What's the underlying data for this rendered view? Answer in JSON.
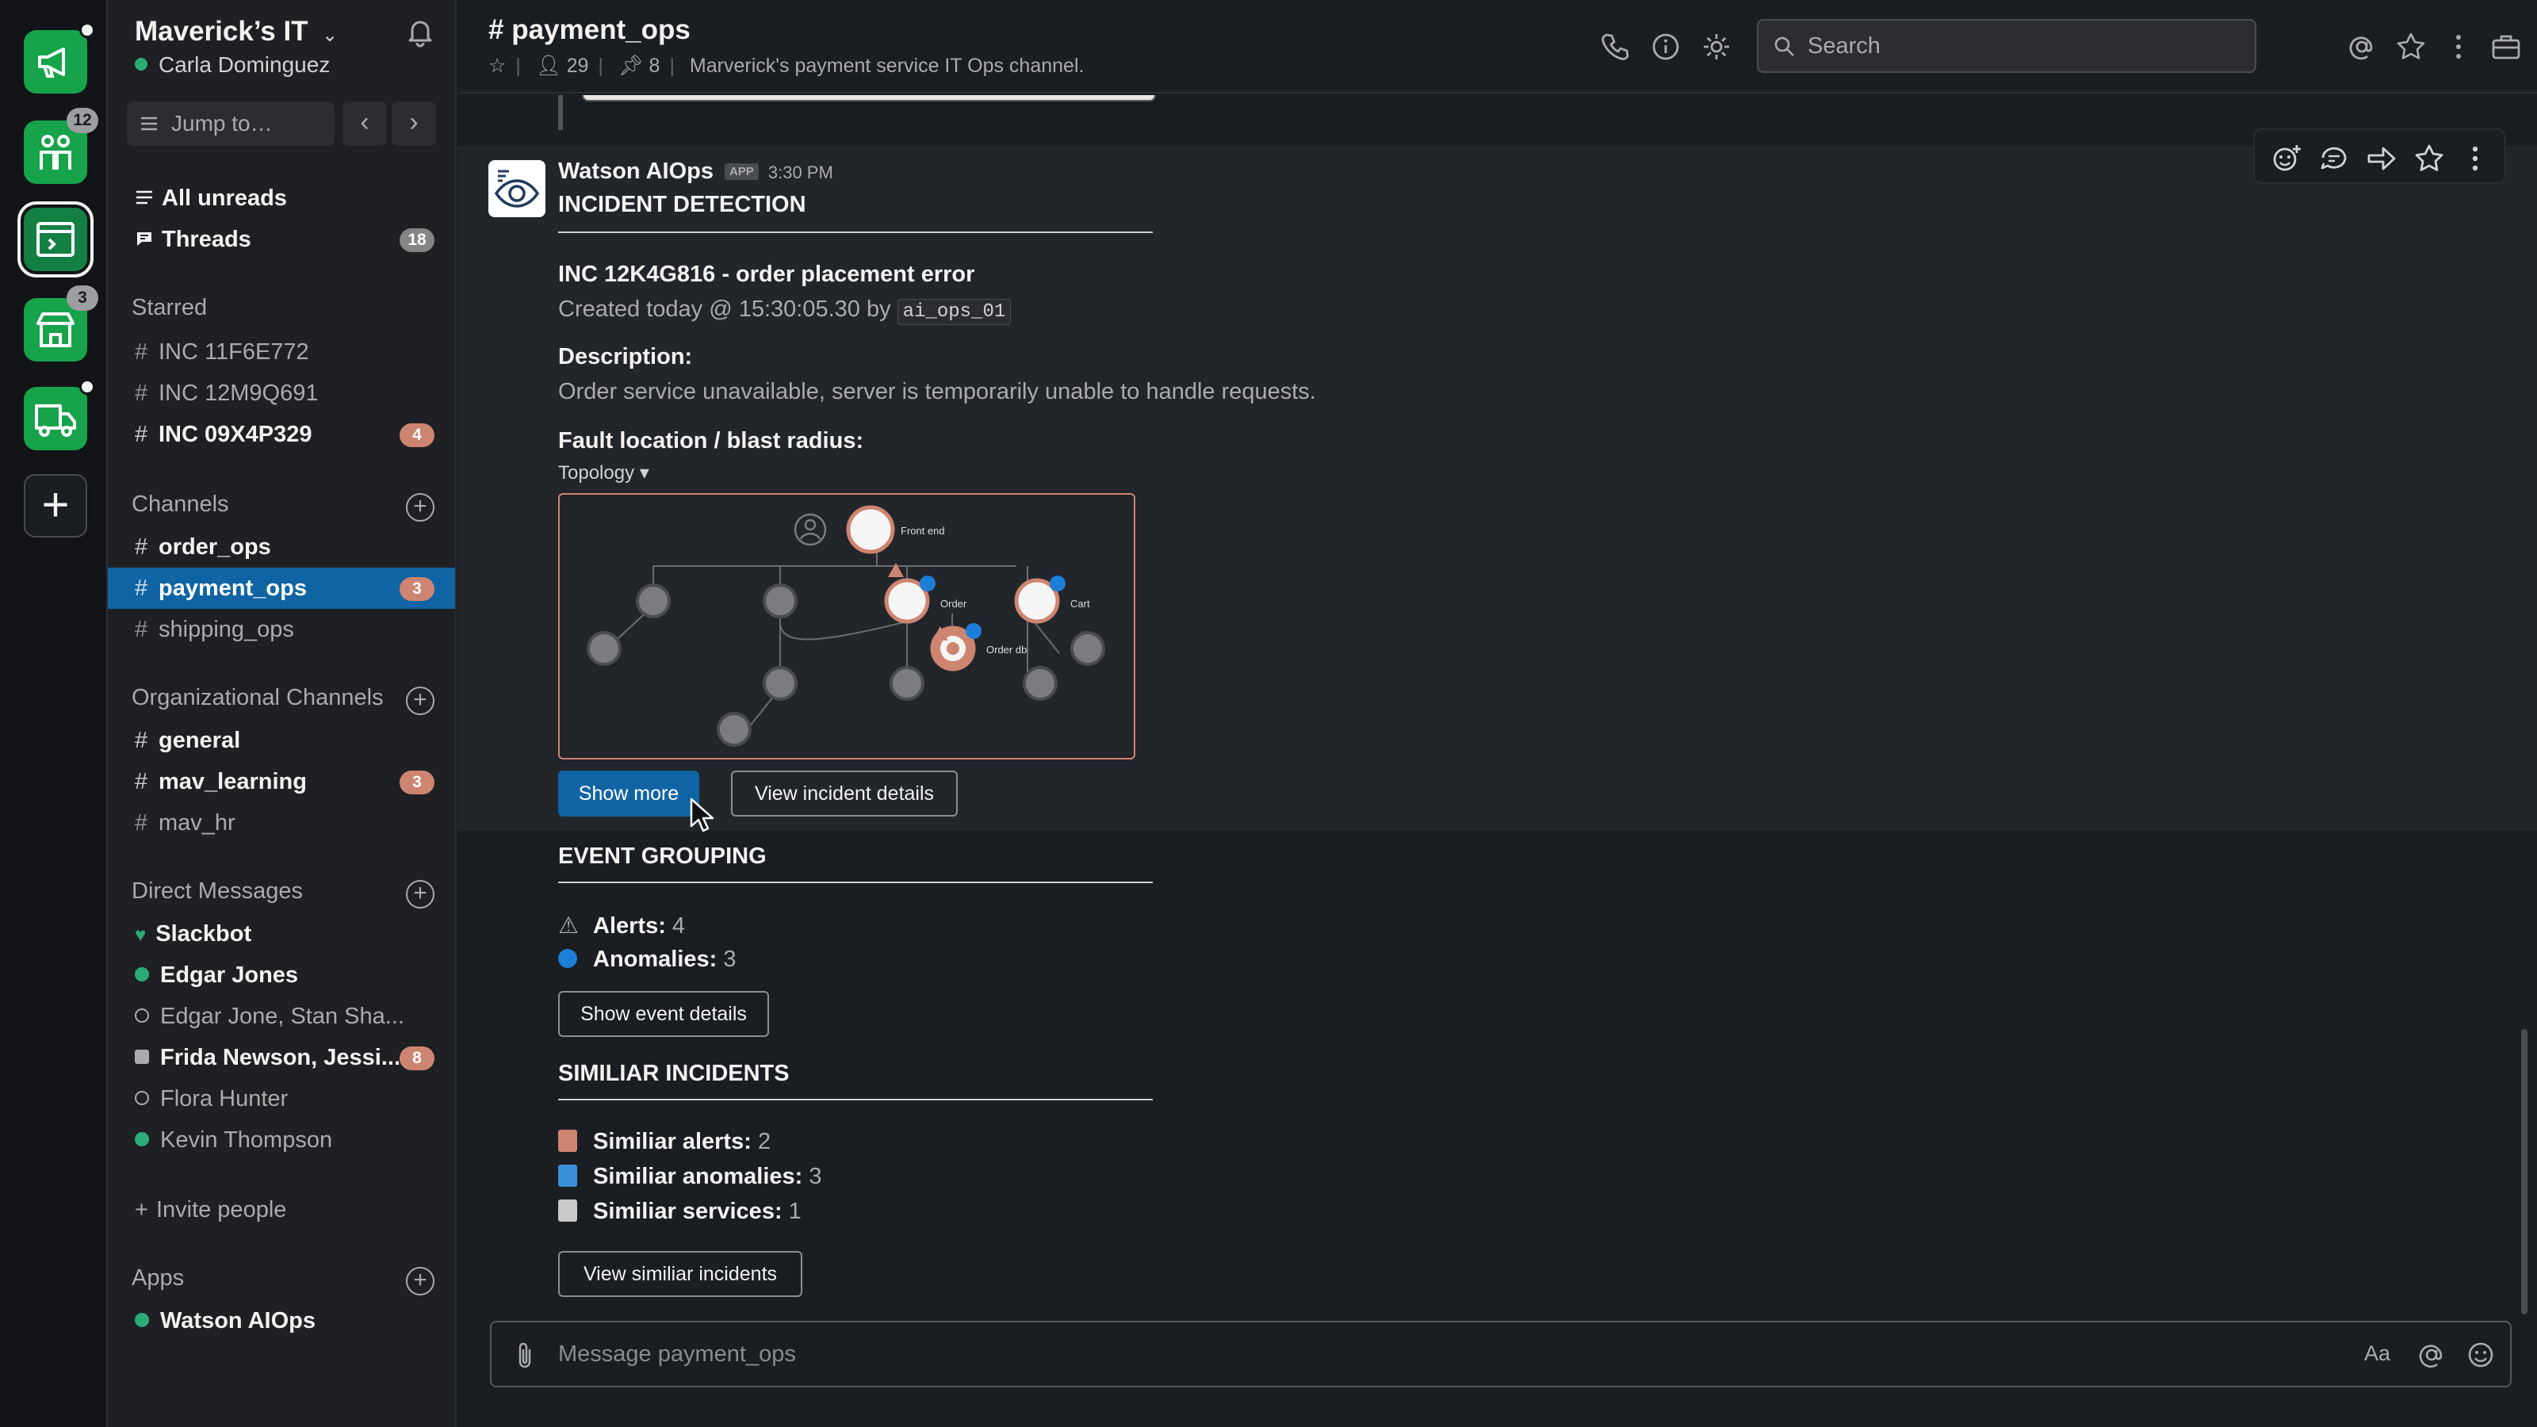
{
  "workspace": {
    "name": "Maverick’s IT",
    "user": "Carla Dominguez",
    "jump_placeholder": "Jump to…",
    "rail": [
      {
        "icon": "megaphone-icon",
        "badge": ""
      },
      {
        "icon": "people-icon",
        "badge": "12"
      },
      {
        "icon": "terminal-icon",
        "badge": ""
      },
      {
        "icon": "storefront-icon",
        "badge": "3"
      },
      {
        "icon": "delivery-truck-icon",
        "badge": ""
      }
    ]
  },
  "sidebar": {
    "top": [
      {
        "label": "All unreads",
        "icon": "list-icon"
      },
      {
        "label": "Threads",
        "icon": "thread-icon",
        "badge": "18"
      }
    ],
    "starred_title": "Starred",
    "starred": [
      {
        "label": "INC 11F6E772",
        "badge": ""
      },
      {
        "label": "INC 12M9Q691",
        "badge": ""
      },
      {
        "label": "INC 09X4P329",
        "badge": "4"
      }
    ],
    "channels_title": "Channels",
    "channels": [
      {
        "label": "order_ops",
        "badge": ""
      },
      {
        "label": "payment_ops",
        "badge": "3"
      },
      {
        "label": "shipping_ops",
        "badge": ""
      }
    ],
    "org_title": "Organizational Channels",
    "org_channels": [
      {
        "label": "general",
        "badge": ""
      },
      {
        "label": "mav_learning",
        "badge": "3"
      },
      {
        "label": "mav_hr",
        "badge": ""
      }
    ],
    "dm_title": "Direct Messages",
    "dms": [
      {
        "label": "Slackbot",
        "badge": ""
      },
      {
        "label": "Edgar Jones",
        "badge": ""
      },
      {
        "label": "Edgar Jone, Stan Sha...",
        "badge": ""
      },
      {
        "label": "Frida Newson, Jessi...",
        "badge": "8"
      },
      {
        "label": "Flora Hunter",
        "badge": ""
      },
      {
        "label": "Kevin Thompson",
        "badge": ""
      }
    ],
    "invite": "Invite people",
    "apps_title": "Apps",
    "apps": [
      {
        "label": "Watson AIOps"
      }
    ]
  },
  "header": {
    "channel": "# payment_ops",
    "members": "29",
    "pins": "8",
    "topic": "Marverick's payment service IT Ops channel.",
    "search_placeholder": "Search"
  },
  "message": {
    "sender": "Watson AIOps",
    "app_tag": "APP",
    "time": "3:30 PM",
    "incident_detection": "INCIDENT DETECTION",
    "incident_title": "INC 12K4G816 - order placement error",
    "created_prefix": "Created today @ 15:30:05.30 by",
    "created_by": "ai_ops_01",
    "description_label": "Description:",
    "description": "Order service unavailable, server is temporarily unable to handle requests.",
    "fault_label": "Fault location / blast radius:",
    "topology_dropdown": "Topology",
    "topology_nodes": {
      "front_end": "Front end",
      "order": "Order",
      "cart": "Cart",
      "order_db": "Order db"
    },
    "show_more": "Show more",
    "view_incident": "View incident details",
    "event_grouping": "EVENT GROUPING",
    "alerts_label": "Alerts:",
    "alerts_value": "4",
    "anomalies_label": "Anomalies:",
    "anomalies_value": "3",
    "show_event_details": "Show event details",
    "similar_incidents": "SIMILIAR INCIDENTS",
    "similar_alerts_label": "Similiar alerts:",
    "similar_alerts_value": "2",
    "similar_anomalies_label": "Similiar anomalies:",
    "similar_anomalies_value": "3",
    "similar_services_label": "Similiar services:",
    "similar_services_value": "1",
    "view_similar": "View similiar incidents"
  },
  "composer": {
    "placeholder": "Message payment_ops",
    "format_label": "Aa"
  },
  "colors": {
    "accent": "#1164a3",
    "badge": "#cd8571",
    "online": "#2bac76",
    "workspace_green": "#16a34a"
  }
}
